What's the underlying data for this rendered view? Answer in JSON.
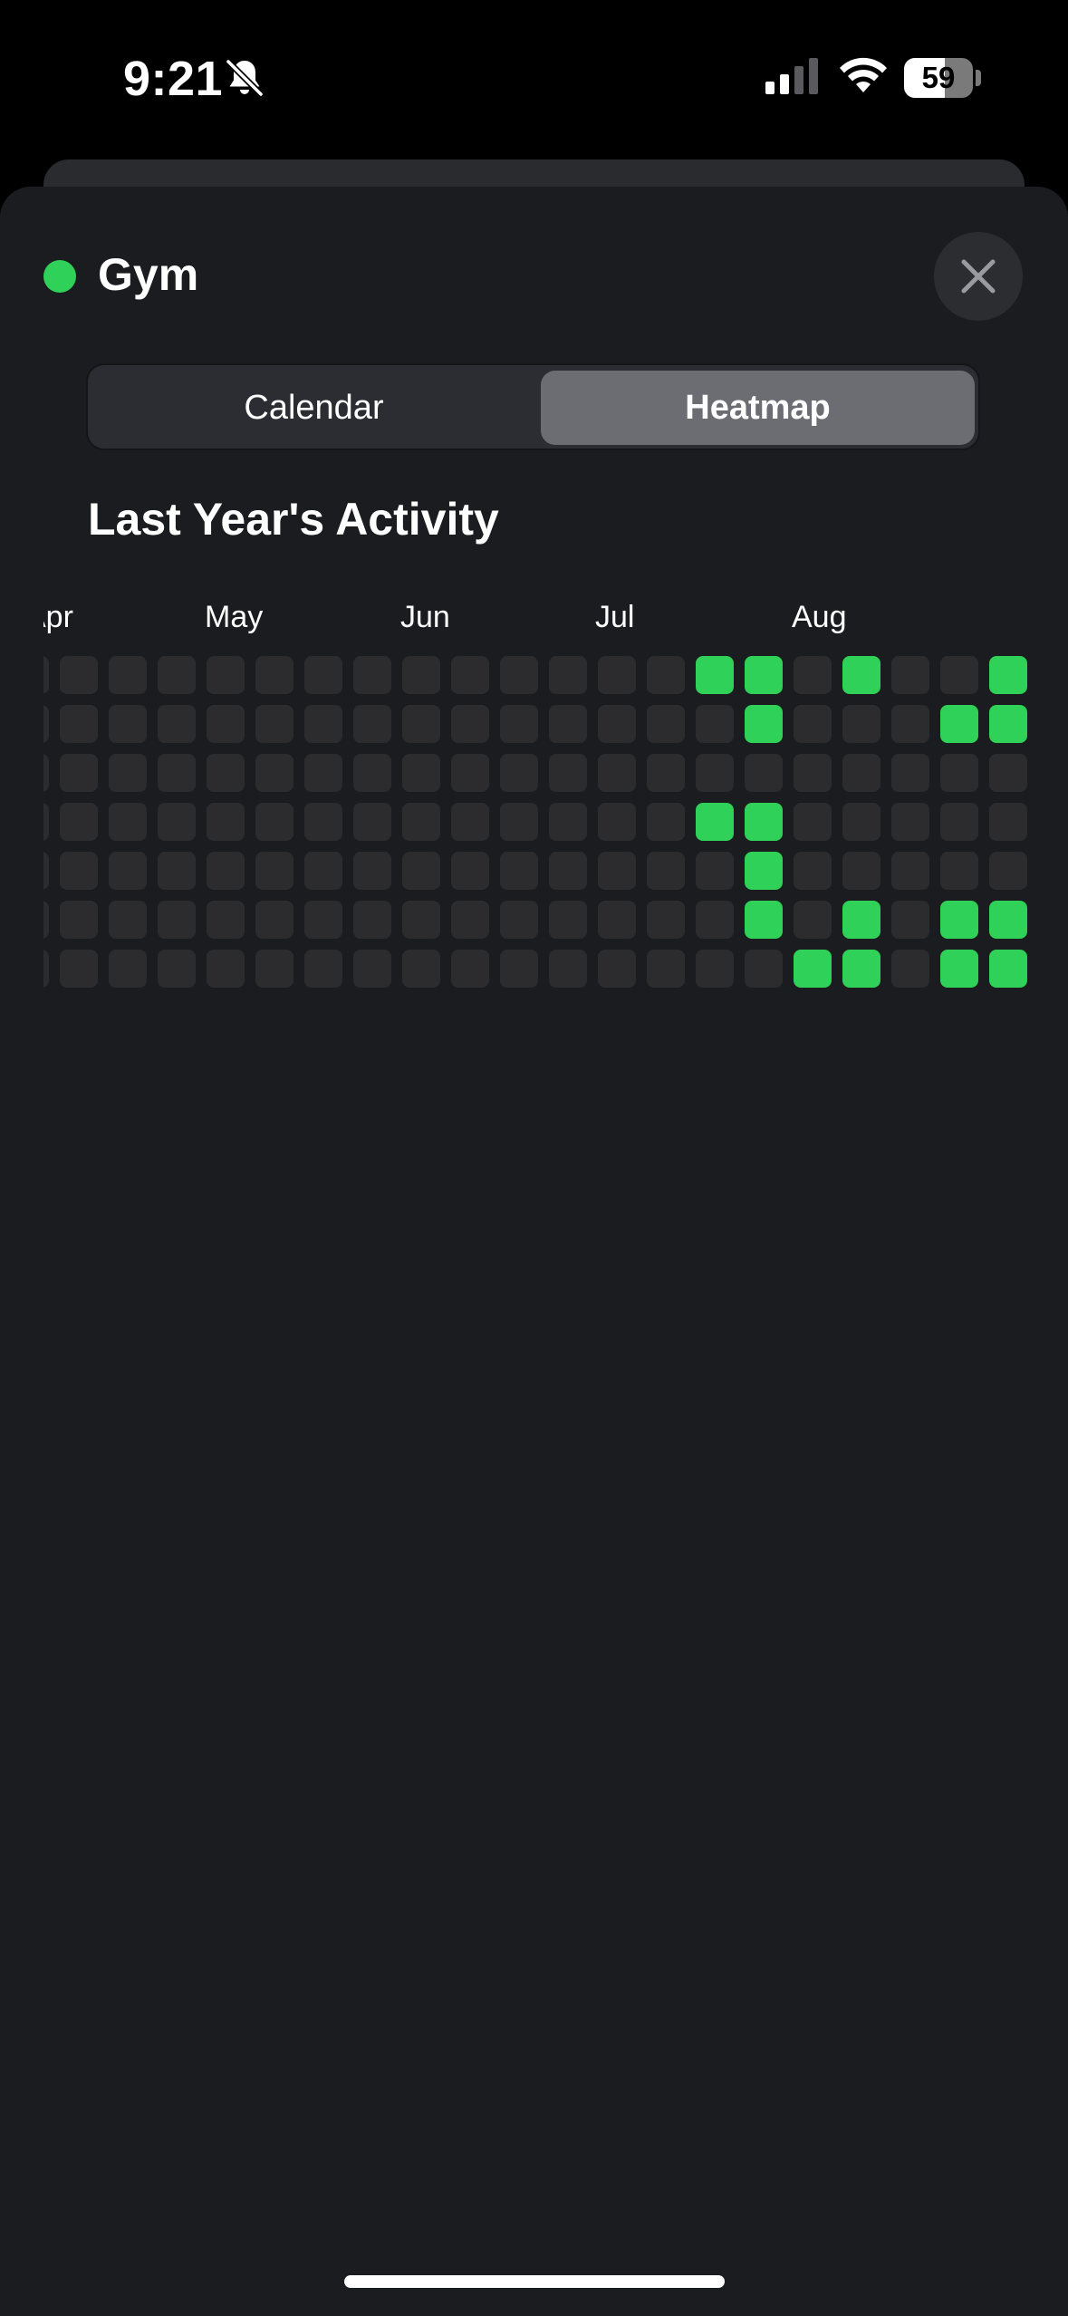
{
  "status_bar": {
    "time": "9:21",
    "battery": "59",
    "battery_level": 0.59,
    "icons": [
      "bell-slash-icon",
      "cellular-signal-icon",
      "wifi-icon",
      "battery-icon"
    ]
  },
  "habit": {
    "title": "Gym",
    "color": "#30d158",
    "close_icon": "xmark-icon"
  },
  "segmented_control": {
    "tabs": [
      {
        "label": "Calendar",
        "selected": false
      },
      {
        "label": "Heatmap",
        "selected": true
      }
    ]
  },
  "heatmap": {
    "title": "Last Year's Activity",
    "months": [
      "Apr",
      "May",
      "Jun",
      "Jul",
      "Aug"
    ],
    "empty_color": "#2c2c2e",
    "active_color": "#30d158",
    "weeks": [
      [
        0,
        0,
        0,
        0,
        0,
        0,
        0
      ],
      [
        0,
        0,
        0,
        0,
        0,
        0,
        0
      ],
      [
        0,
        0,
        0,
        0,
        0,
        0,
        0
      ],
      [
        0,
        0,
        0,
        0,
        0,
        0,
        0
      ],
      [
        0,
        0,
        0,
        0,
        0,
        0,
        0
      ],
      [
        0,
        0,
        0,
        0,
        0,
        0,
        0
      ],
      [
        0,
        0,
        0,
        0,
        0,
        0,
        0
      ],
      [
        0,
        0,
        0,
        0,
        0,
        0,
        0
      ],
      [
        0,
        0,
        0,
        0,
        0,
        0,
        0
      ],
      [
        0,
        0,
        0,
        0,
        0,
        0,
        0
      ],
      [
        0,
        0,
        0,
        0,
        0,
        0,
        0
      ],
      [
        0,
        0,
        0,
        0,
        0,
        0,
        0
      ],
      [
        0,
        0,
        0,
        0,
        0,
        0,
        0
      ],
      [
        0,
        0,
        0,
        0,
        0,
        0,
        0
      ],
      [
        1,
        0,
        0,
        1,
        0,
        0,
        0
      ],
      [
        1,
        1,
        0,
        1,
        1,
        1,
        0
      ],
      [
        0,
        0,
        0,
        0,
        0,
        0,
        1
      ],
      [
        1,
        0,
        0,
        0,
        0,
        1,
        1
      ],
      [
        0,
        0,
        0,
        0,
        0,
        0,
        0
      ],
      [
        0,
        1,
        0,
        0,
        0,
        1,
        1
      ],
      [
        1,
        1,
        0,
        0,
        0,
        1,
        1
      ]
    ]
  }
}
